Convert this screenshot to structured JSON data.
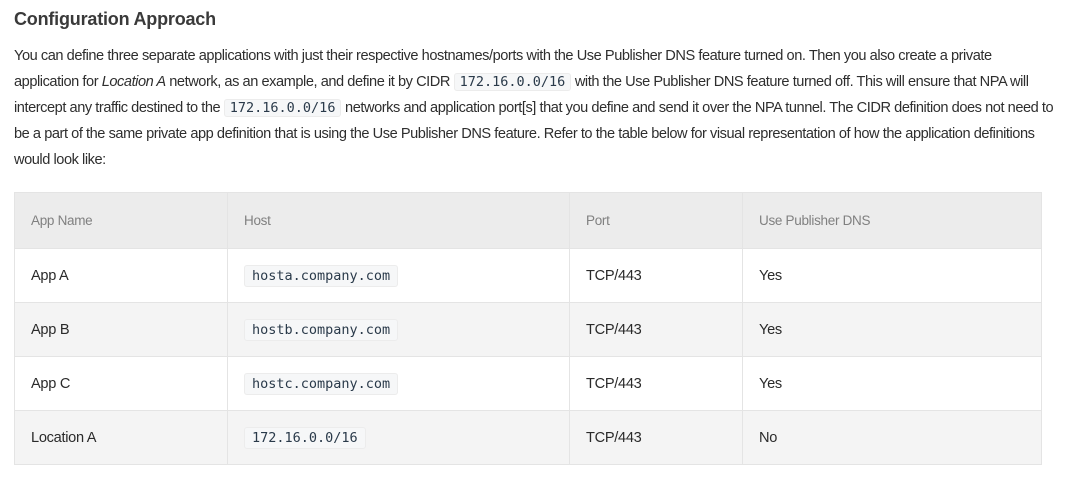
{
  "section": {
    "title": "Configuration Approach"
  },
  "paragraph": {
    "p1": "You can define three separate applications with just their respective hostnames/ports with the Use Publisher DNS feature turned on. Then you also create a private application for ",
    "p1_em": "Location A",
    "p2": " network, as an example, and define it by CIDR ",
    "code1": "172.16.0.0/16",
    "p3": " with the Use Publisher DNS feature turned off. This will ensure that NPA will intercept any traffic destined to the ",
    "code2": "172.16.0.0/16",
    "p4": " networks and application port[s] that you define and send it over the NPA tunnel. The CIDR definition does not need to be a part of the same private app definition that is using the Use Publisher DNS feature. Refer to the table below for visual representation of how the application definitions would look like:"
  },
  "table": {
    "headers": [
      "App Name",
      "Host",
      "Port",
      "Use Publisher DNS"
    ],
    "rows": [
      [
        "App A",
        "hosta.company.com",
        "TCP/443",
        "Yes"
      ],
      [
        "App B",
        "hostb.company.com",
        "TCP/443",
        "Yes"
      ],
      [
        "App C",
        "hostc.company.com",
        "TCP/443",
        "Yes"
      ],
      [
        "Location A",
        "172.16.0.0/16",
        "TCP/443",
        "No"
      ]
    ]
  }
}
